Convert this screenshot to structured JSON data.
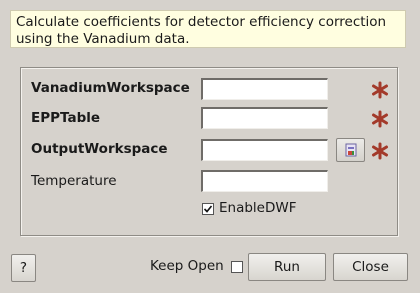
{
  "description": "Calculate coefficients for detector efficiency correction using the Vanadium data.",
  "fields": [
    {
      "label": "VanadiumWorkspace",
      "value": "",
      "required": true
    },
    {
      "label": "EPPTable",
      "value": "",
      "required": true
    },
    {
      "label": "OutputWorkspace",
      "value": "",
      "required": true
    },
    {
      "label": "Temperature",
      "value": "",
      "required": false
    }
  ],
  "enable_dwf": {
    "label": "EnableDWF",
    "checked": true
  },
  "footer": {
    "help_label": "?",
    "keep_open_label": "Keep Open",
    "keep_open_checked": false,
    "run_label": "Run",
    "close_label": "Close"
  },
  "colors": {
    "required_star": "#a33a2a",
    "description_bg": "#fffee0"
  },
  "icons": {
    "required": "asterisk-icon",
    "browse": "browse-workspace-icon"
  }
}
